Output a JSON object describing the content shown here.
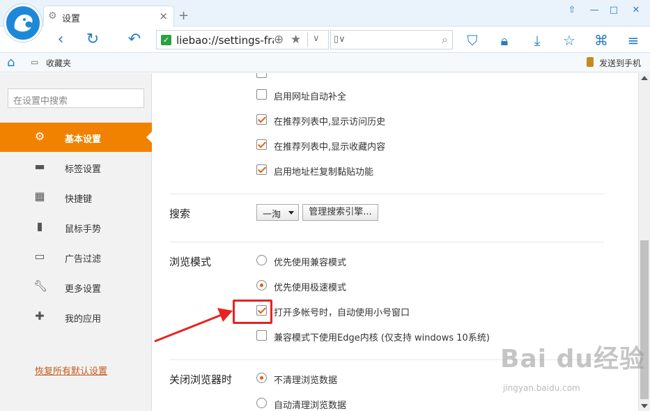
{
  "tab": {
    "title": "设置",
    "close": "×",
    "new": "+"
  },
  "window": {
    "pin": "⇧",
    "min": "—",
    "max": "□",
    "close": "✕"
  },
  "address": {
    "url": "liebao://settings-frame/"
  },
  "bookmarks": {
    "folder_label": "收藏夹",
    "send_label": "发送到手机"
  },
  "sidebar": {
    "search_placeholder": "在设置中搜索",
    "items": [
      {
        "label": "基本设置",
        "icon": "gear-icon",
        "active": true
      },
      {
        "label": "标签设置",
        "icon": "tab-icon"
      },
      {
        "label": "快捷键",
        "icon": "keyboard-icon"
      },
      {
        "label": "鼠标手势",
        "icon": "mouse-icon"
      },
      {
        "label": "广告过滤",
        "icon": "window-icon"
      },
      {
        "label": "更多设置",
        "icon": "wrench-icon"
      },
      {
        "label": "我的应用",
        "icon": "puzzle-icon"
      }
    ],
    "restore_link": "恢复所有默认设置"
  },
  "main": {
    "address_bar_options": [
      {
        "label": "启用网址自动补全",
        "checked": false
      },
      {
        "label": "在推荐列表中,显示访问历史",
        "checked": true
      },
      {
        "label": "在推荐列表中,显示收藏内容",
        "checked": true
      },
      {
        "label": "启用地址栏复制黏贴功能",
        "checked": true
      }
    ],
    "search": {
      "title": "搜索",
      "engine": "一淘",
      "manage_button": "管理搜索引擎..."
    },
    "browse_mode": {
      "title": "浏览模式",
      "radios": [
        {
          "label": "优先使用兼容模式",
          "selected": false
        },
        {
          "label": "优先使用极速模式",
          "selected": true
        }
      ],
      "checks": [
        {
          "label": "打开多帐号时，自动使用小号窗口",
          "checked": true
        },
        {
          "label": "兼容模式下使用Edge内核 (仅支持 windows 10系统)",
          "checked": false
        }
      ]
    },
    "on_close": {
      "title": "关闭浏览器时",
      "radios": [
        {
          "label": "不清理浏览数据",
          "selected": true
        },
        {
          "label": "自动清理浏览数据",
          "selected": false
        }
      ]
    }
  },
  "watermark": {
    "brand": "Bai du经验",
    "url": "jingyan.baidu.com"
  },
  "colors": {
    "accent": "#f08200",
    "link": "#c65b1e",
    "highlight": "#e8231f",
    "brand_blue": "#2a7bc4"
  }
}
